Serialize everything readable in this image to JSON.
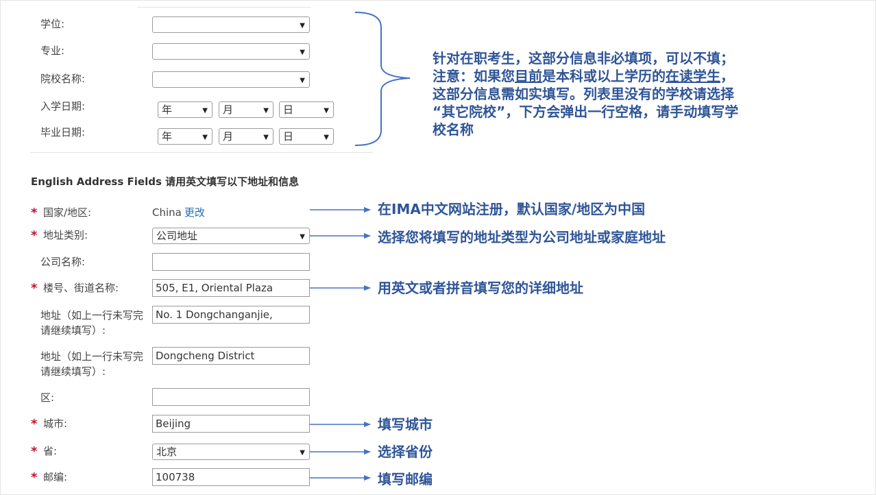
{
  "education": {
    "degree_label": "学位:",
    "major_label": "专业:",
    "school_label": "院校名称:",
    "start_label": "入学日期:",
    "end_label": "毕业日期:",
    "year_placeholder": "年",
    "month_placeholder": "月",
    "day_placeholder": "日"
  },
  "education_note": {
    "line1": "针对在职考生，这部分信息非必填项，可以不填；",
    "line2_a": "注意：如果您",
    "line2_b": "目前",
    "line2_c": "是本科或以上学历的",
    "line2_d": "在读学生",
    "line2_e": "，",
    "line3": "这部分信息需如实填写。列表里没有的学校请选择",
    "line4": "“其它院校”，下方会弹出一行空格，请手动填写学",
    "line5": "校名称"
  },
  "address": {
    "section_title": "English Address Fields 请用英文填写以下地址和信息",
    "country_label": "国家/地区:",
    "country_value": "China",
    "country_change": "更改",
    "type_label": "地址类别:",
    "type_value": "公司地址",
    "company_label": "公司名称:",
    "company_value": "",
    "street_label": "楼号、街道名称:",
    "street_value": "505, E1, Oriental Plaza",
    "addr2_label": "地址（如上一行未写完请继续填写）:",
    "addr2_value": "No. 1 Dongchanganjie,",
    "addr3_label": "地址（如上一行未写完请继续填写）:",
    "addr3_value": "Dongcheng District",
    "district_label": "区:",
    "district_value": "",
    "city_label": "城市:",
    "city_value": "Beijing",
    "province_label": "省:",
    "province_value": "北京",
    "zip_label": "邮编:",
    "zip_value": "100738",
    "required_mark": "*"
  },
  "annotations": {
    "country": "在IMA中文网站注册，默认国家/地区为中国",
    "type": "选择您将填写的地址类型为公司地址或家庭地址",
    "street": "用英文或者拼音填写您的详细地址",
    "city": "填写城市",
    "province": "选择省份",
    "zip": "填写邮编"
  },
  "colors": {
    "annotation_blue": "#2f5597",
    "arrow_blue": "#4472c4",
    "required_red": "#c8102e",
    "link_blue": "#1f6fb5"
  }
}
